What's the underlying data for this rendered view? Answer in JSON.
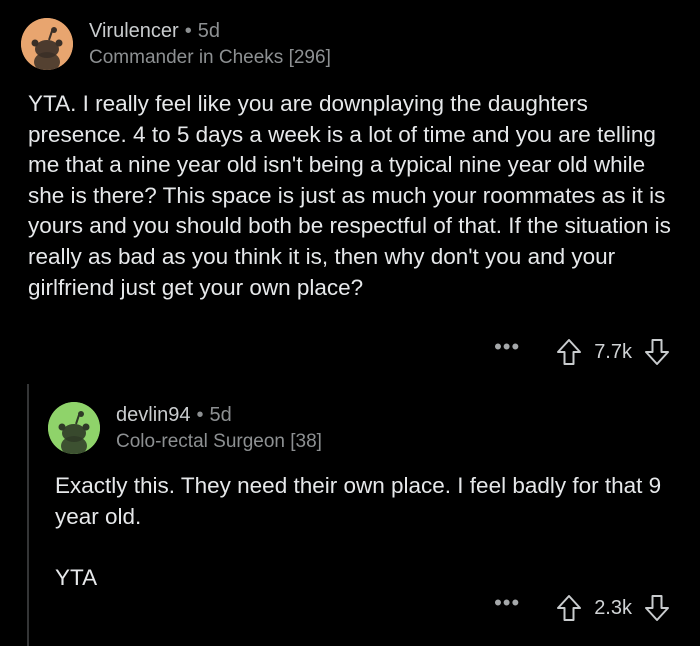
{
  "comments": [
    {
      "username": "Virulencer",
      "separator": "•",
      "age": "5d",
      "flair": "Commander in Cheeks [296]",
      "avatar_color": "#e8a56f",
      "paragraphs": [
        "YTA. I really feel like you are downplaying the daughters presence. 4 to 5 days a week is a lot of time and you are telling me that a nine year old isn't being a typical nine year old while she is there? This space is just as much your roommates as it is yours and you should both be respectful of that. If the situation is really as bad as you think it is, then why don't you and your girlfriend just get your own place?"
      ],
      "more": "•••",
      "score": "7.7k"
    },
    {
      "username": "devlin94",
      "separator": "•",
      "age": "5d",
      "flair": "Colo-rectal Surgeon [38]",
      "avatar_color": "#8fd36a",
      "paragraphs": [
        "Exactly this. They need their own place. I feel badly for that 9 year old.",
        "YTA"
      ],
      "more": "•••",
      "score": "2.3k"
    }
  ],
  "icons": {
    "avatar": "snoo-avatar-icon",
    "upvote": "upvote-arrow-icon",
    "downvote": "downvote-arrow-icon",
    "more": "more-options-icon"
  }
}
